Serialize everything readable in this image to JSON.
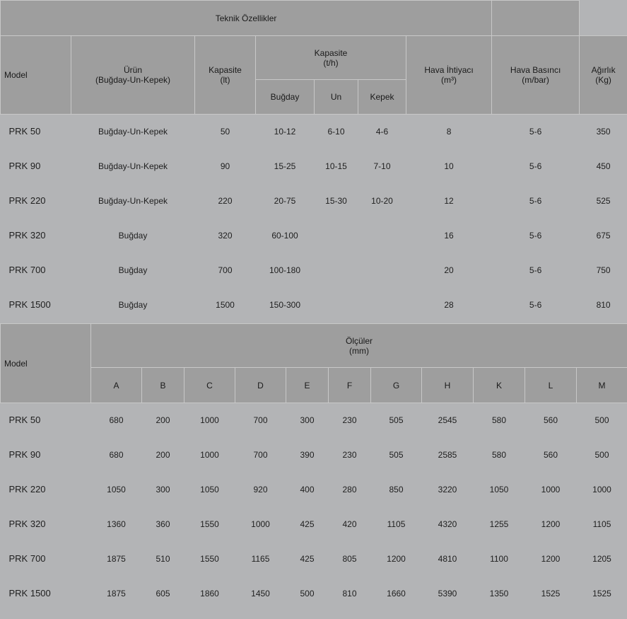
{
  "table1": {
    "title": "Teknik Özellikler",
    "headers": {
      "model": "Model",
      "urun": [
        "Ürün",
        "(Buğday-Un-Kepek)"
      ],
      "kapasite_lt": [
        "Kapasite",
        "(lt)"
      ],
      "kapasite_th": [
        "Kapasite",
        "(t/h)"
      ],
      "bugday": "Buğday",
      "un": "Un",
      "kepek": "Kepek",
      "hava_ihtiyaci": [
        "Hava İhtiyacı",
        "(m³)"
      ],
      "hava_basinci": [
        "Hava Basıncı",
        "(m/bar)"
      ],
      "agirlik": [
        "Ağırlık",
        "(Kg)"
      ]
    },
    "rows": [
      [
        "PRK 50",
        "Buğday-Un-Kepek",
        "50",
        "10-12",
        "6-10",
        "4-6",
        "8",
        "5-6",
        "350"
      ],
      [
        "PRK 90",
        "Buğday-Un-Kepek",
        "90",
        "15-25",
        "10-15",
        "7-10",
        "10",
        "5-6",
        "450"
      ],
      [
        "PRK 220",
        "Buğday-Un-Kepek",
        "220",
        "20-75",
        "15-30",
        "10-20",
        "12",
        "5-6",
        "525"
      ],
      [
        "PRK 320",
        "Buğday",
        "320",
        "60-100",
        "",
        "",
        "16",
        "5-6",
        "675"
      ],
      [
        "PRK 700",
        "Buğday",
        "700",
        "100-180",
        "",
        "",
        "20",
        "5-6",
        "750"
      ],
      [
        "PRK 1500",
        "Buğday",
        "1500",
        "150-300",
        "",
        "",
        "28",
        "5-6",
        "810"
      ]
    ]
  },
  "table2": {
    "headers": {
      "model": "Model",
      "olculer": [
        "Ölçüler",
        "(mm)"
      ],
      "columns": [
        "A",
        "B",
        "C",
        "D",
        "E",
        "F",
        "G",
        "H",
        "K",
        "L",
        "M"
      ]
    },
    "rows": [
      [
        "PRK 50",
        "680",
        "200",
        "1000",
        "700",
        "300",
        "230",
        "505",
        "2545",
        "580",
        "560",
        "500"
      ],
      [
        "PRK 90",
        "680",
        "200",
        "1000",
        "700",
        "390",
        "230",
        "505",
        "2585",
        "580",
        "560",
        "500"
      ],
      [
        "PRK 220",
        "1050",
        "300",
        "1050",
        "920",
        "400",
        "280",
        "850",
        "3220",
        "1050",
        "1000",
        "1000"
      ],
      [
        "PRK 320",
        "1360",
        "360",
        "1550",
        "1000",
        "425",
        "420",
        "1105",
        "4320",
        "1255",
        "1200",
        "1105"
      ],
      [
        "PRK 700",
        "1875",
        "510",
        "1550",
        "1165",
        "425",
        "805",
        "1200",
        "4810",
        "1100",
        "1200",
        "1205"
      ],
      [
        "PRK 1500",
        "1875",
        "605",
        "1860",
        "1450",
        "500",
        "810",
        "1660",
        "5390",
        "1350",
        "1525",
        "1525"
      ]
    ]
  }
}
